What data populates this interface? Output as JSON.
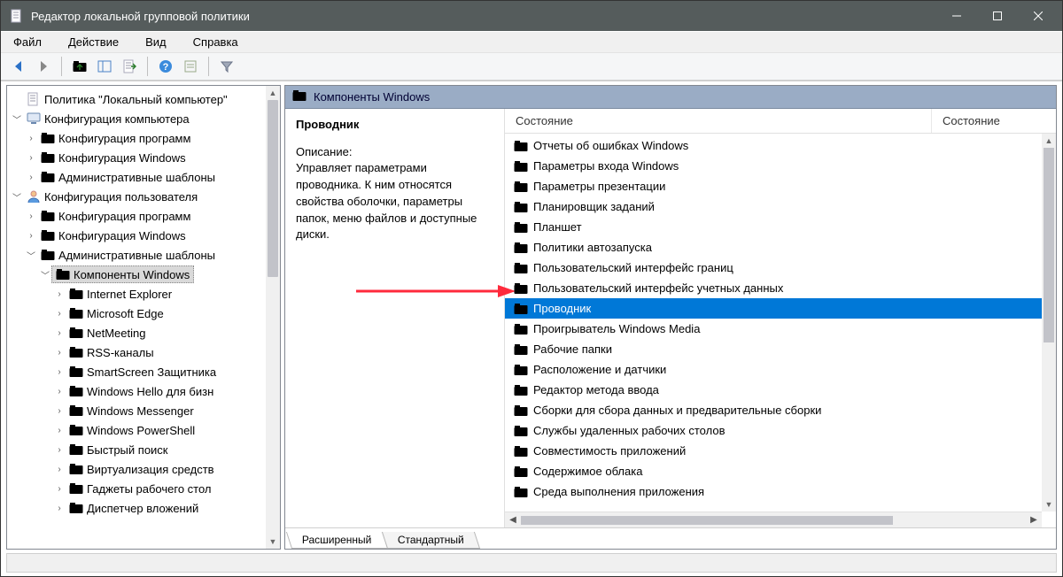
{
  "titlebar": {
    "title": "Редактор локальной групповой политики"
  },
  "menu": {
    "file": "Файл",
    "action": "Действие",
    "view": "Вид",
    "help": "Справка"
  },
  "tree": {
    "root": "Политика \"Локальный компьютер\"",
    "computer_config": "Конфигурация компьютера",
    "cc_soft": "Конфигурация программ",
    "cc_win": "Конфигурация Windows",
    "cc_admin": "Административные шаблоны",
    "user_config": "Конфигурация пользователя",
    "uc_soft": "Конфигурация программ",
    "uc_win": "Конфигурация Windows",
    "uc_admin": "Административные шаблоны",
    "win_components": "Компоненты Windows",
    "children": [
      "Internet Explorer",
      "Microsoft Edge",
      "NetMeeting",
      "RSS-каналы",
      "SmartScreen Защитника",
      "Windows Hello для бизн",
      "Windows Messenger",
      "Windows PowerShell",
      "Быстрый поиск",
      "Виртуализация средств",
      "Гаджеты рабочего стол",
      "Диспетчер вложений"
    ]
  },
  "right": {
    "header": "Компоненты Windows",
    "desc_title": "Проводник",
    "desc_label": "Описание:",
    "desc_text": "Управляет параметрами проводника. К ним относятся свойства оболочки, параметры папок, меню файлов и доступные диски.",
    "col_state": "Состояние",
    "col_state2": "Состояние",
    "items": [
      "Отчеты об ошибках Windows",
      "Параметры входа Windows",
      "Параметры презентации",
      "Планировщик заданий",
      "Планшет",
      "Политики автозапуска",
      "Пользовательский интерфейс границ",
      "Пользовательский интерфейс учетных данных",
      "Проводник",
      "Проигрыватель Windows Media",
      "Рабочие папки",
      "Расположение и датчики",
      "Редактор метода ввода",
      "Сборки для сбора данных и предварительные сборки",
      "Службы удаленных рабочих столов",
      "Совместимость приложений",
      "Содержимое облака",
      "Среда выполнения приложения"
    ],
    "selected_index": 8
  },
  "tabs": {
    "extended": "Расширенный",
    "standard": "Стандартный"
  }
}
